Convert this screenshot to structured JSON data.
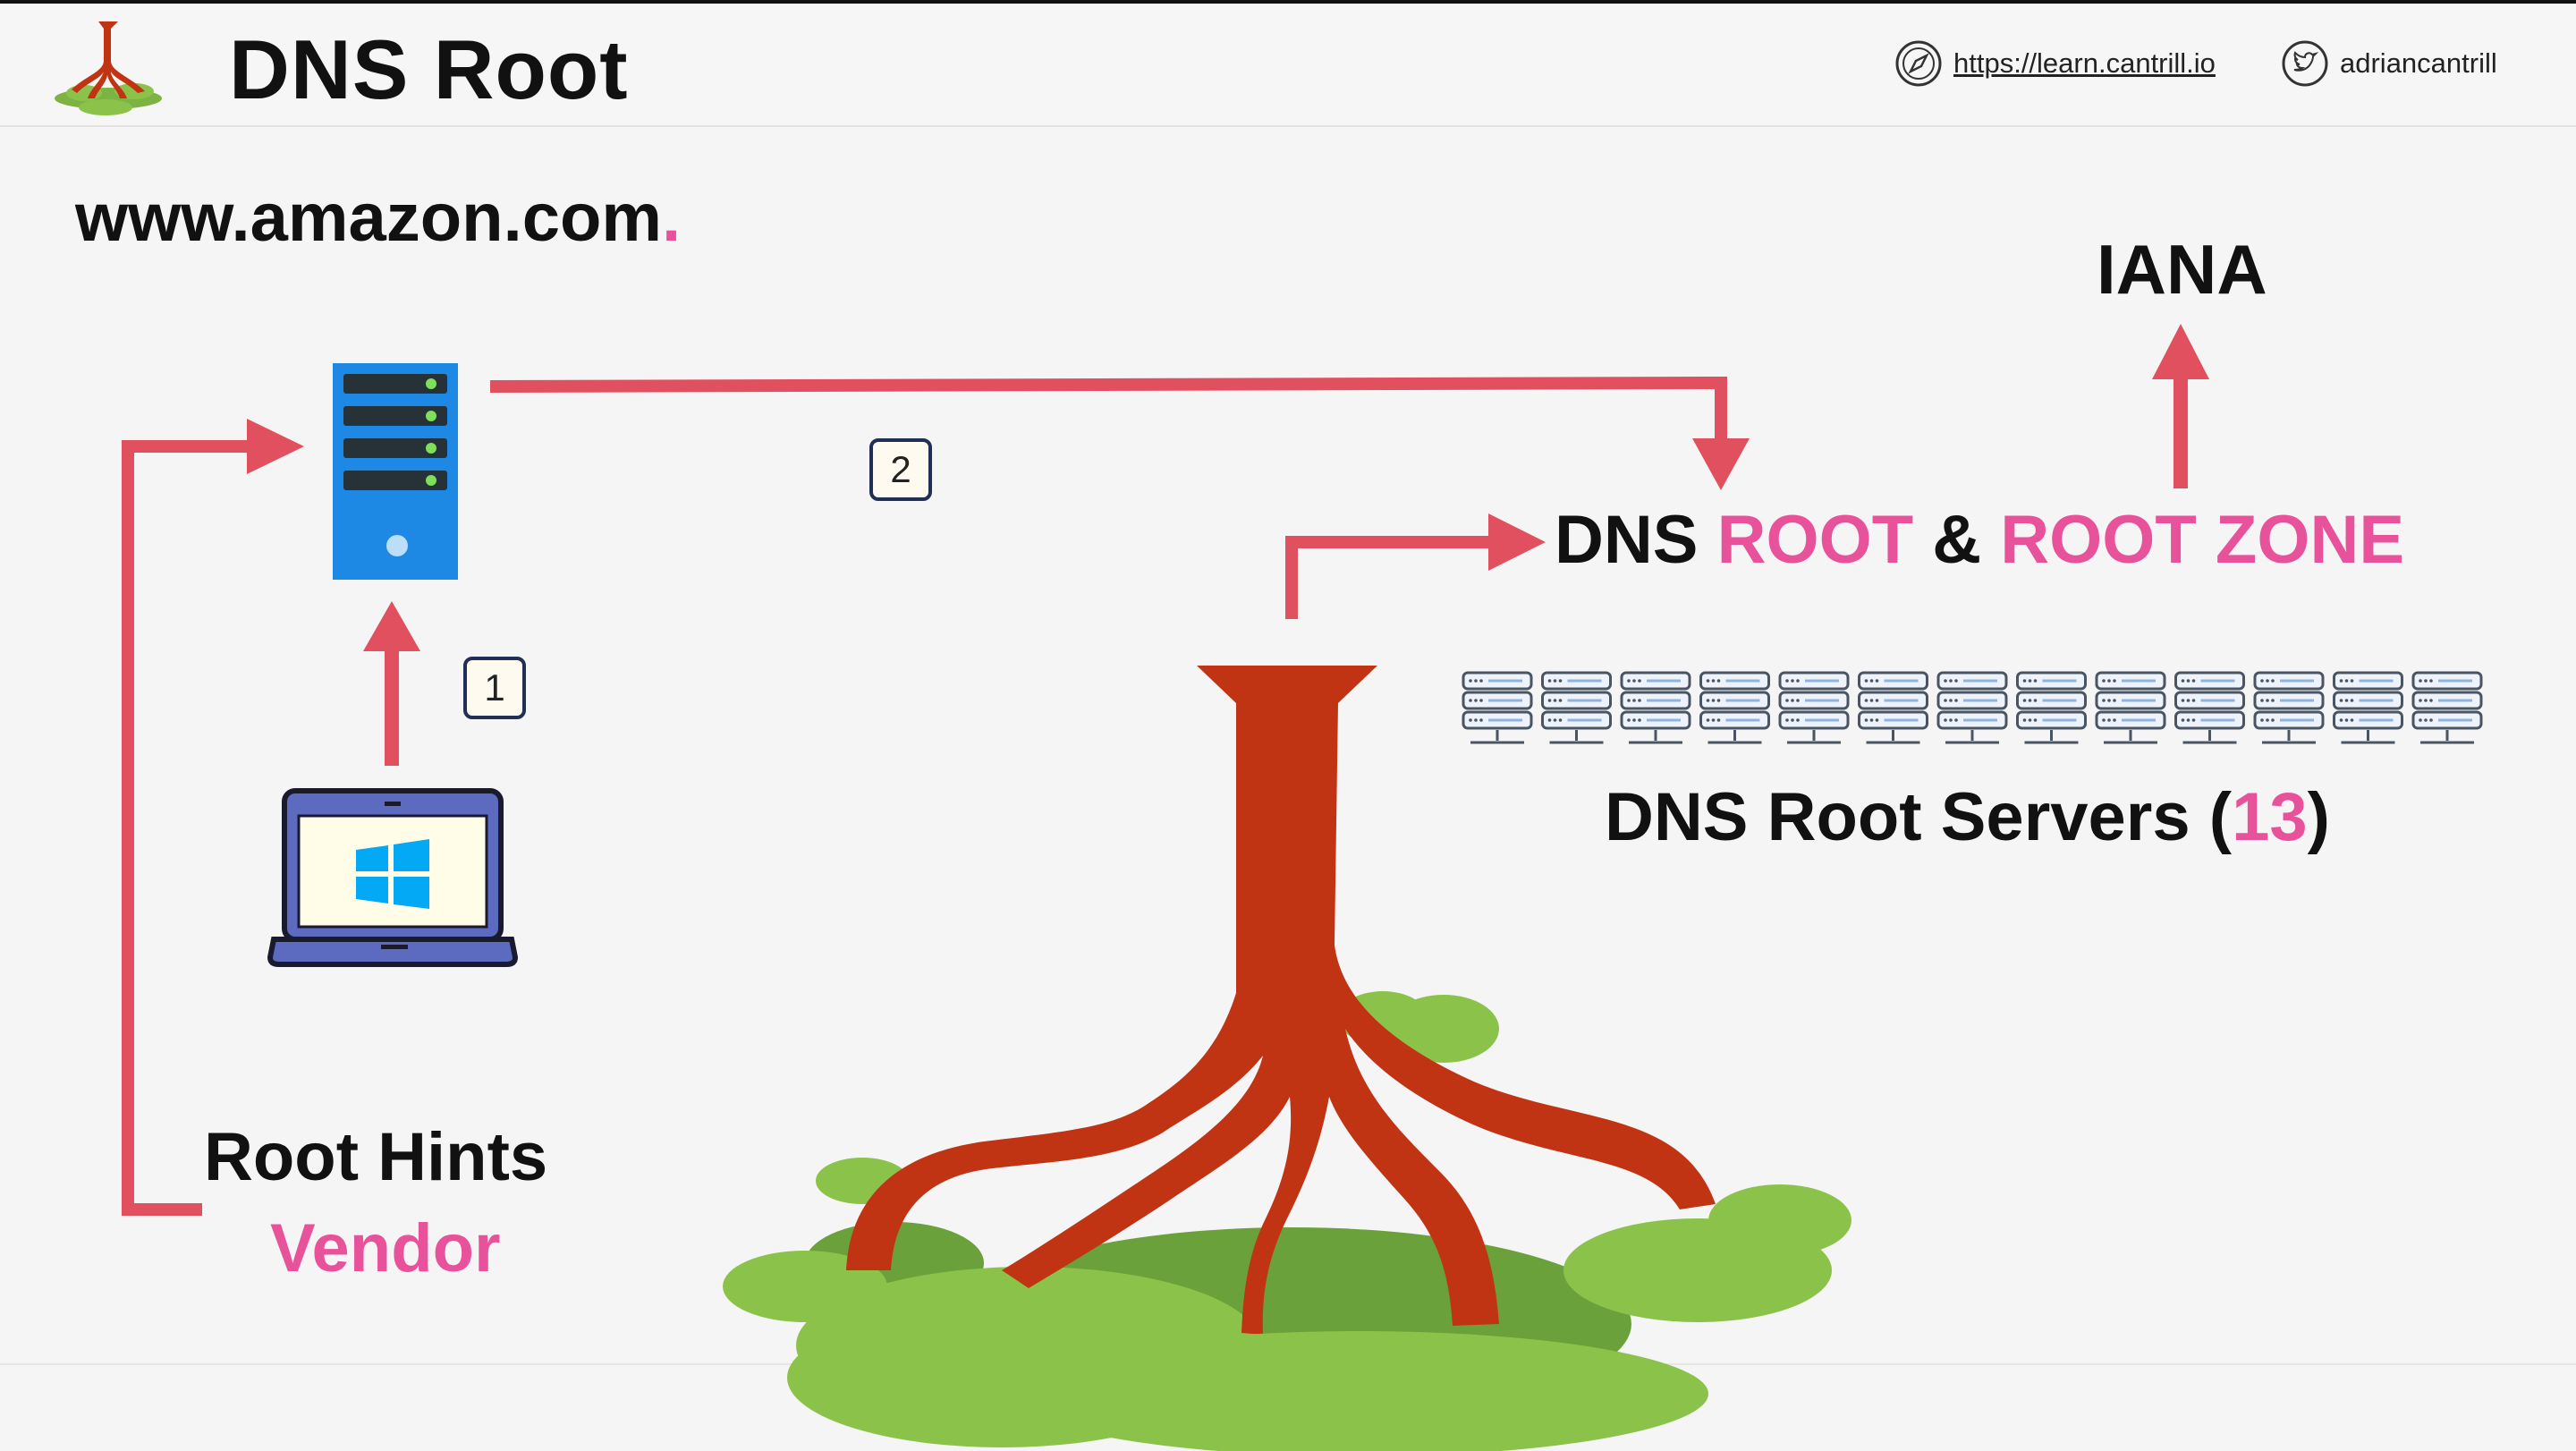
{
  "header": {
    "title": "DNS Root",
    "website": "https://learn.cantrill.io",
    "twitter": "adriancantrill"
  },
  "diagram": {
    "query_domain": "www.amazon.com",
    "query_dot": ".",
    "iana_label": "IANA",
    "dns_root_heading": {
      "part1": "DNS",
      "part2": "ROOT",
      "part3": "&",
      "part4": "ROOT ZONE"
    },
    "root_servers_label": {
      "prefix": "DNS Root Servers (",
      "count": "13",
      "suffix": ")"
    },
    "root_hints_label": "Root Hints",
    "vendor_label": "Vendor",
    "step_badges": [
      "1",
      "2"
    ]
  },
  "colors": {
    "accent_pink": "#e8529b",
    "arrow_red": "#e0505f",
    "tree_trunk": "#c03414",
    "foliage_green": "#8bc34a",
    "server_blue": "#1e88e5"
  }
}
